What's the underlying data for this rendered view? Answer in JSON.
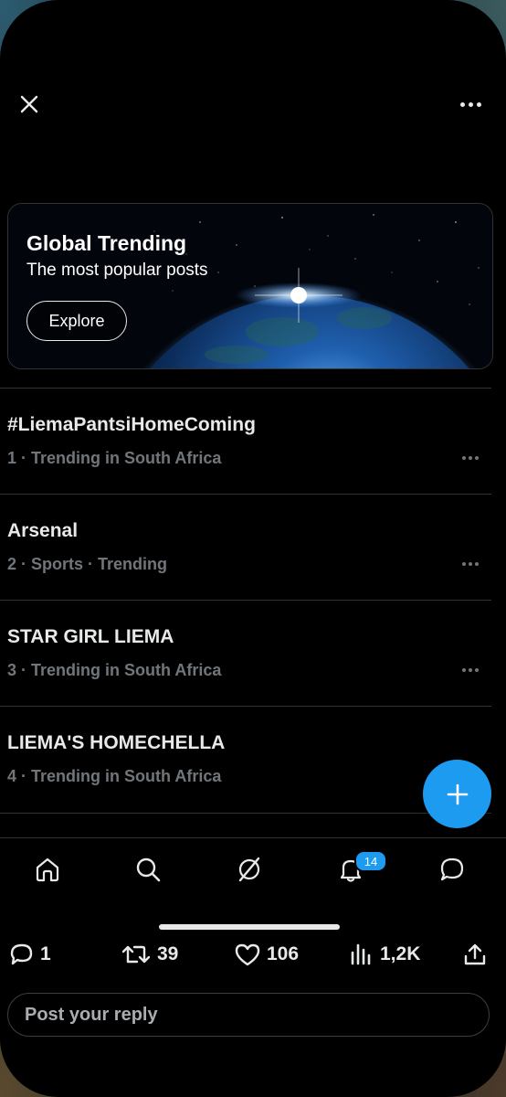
{
  "banner": {
    "title": "Global Trending",
    "subtitle": "The most popular posts",
    "button_label": "Explore"
  },
  "trends": [
    {
      "name": "#LiemaPantsiHomeComing",
      "meta": "1 · Trending in South Africa"
    },
    {
      "name": "Arsenal",
      "meta": "2 · Sports · Trending"
    },
    {
      "name": "STAR GIRL LIEMA",
      "meta": "3 · Trending in South Africa"
    },
    {
      "name": "LIEMA'S HOMECHELLA",
      "meta": "4 · Trending in South Africa"
    }
  ],
  "tabbar": {
    "items": [
      "home-icon",
      "search-icon",
      "grok-icon",
      "notifications-icon",
      "messages-icon"
    ],
    "notification_badge": "14"
  },
  "post_actions": {
    "replies": "1",
    "reposts": "39",
    "likes": "106",
    "views": "1,2K"
  },
  "reply": {
    "placeholder": "Post your reply"
  },
  "colors": {
    "accent": "#1d9bf0",
    "background": "#000000",
    "secondary_text": "#71767b",
    "divider": "#2f3336"
  }
}
